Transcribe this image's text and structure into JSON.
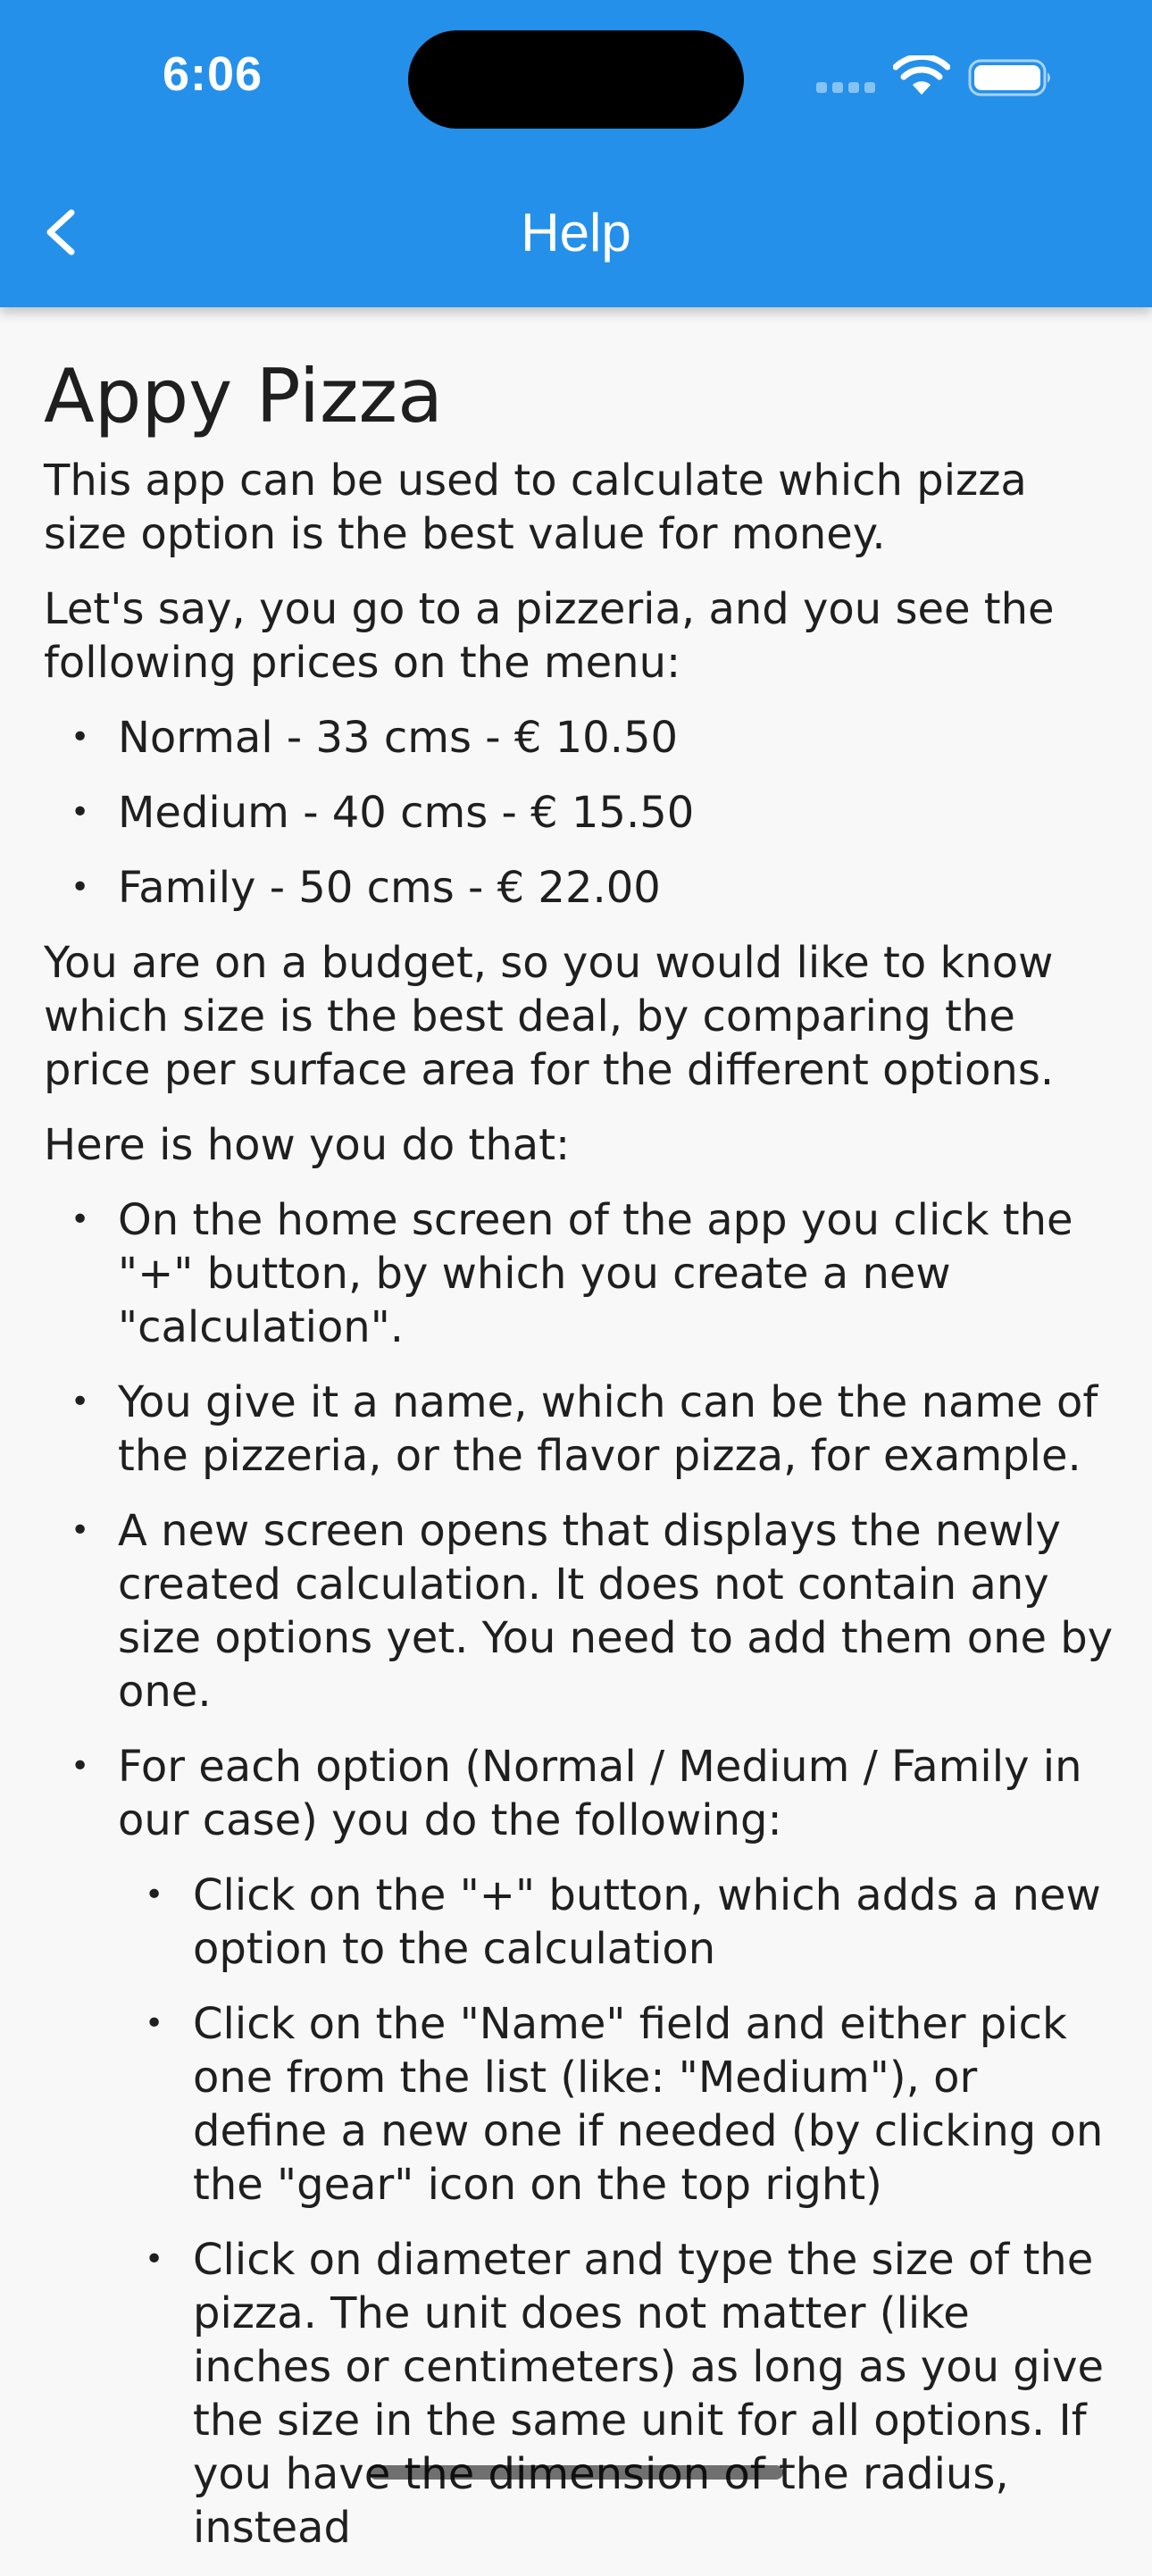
{
  "status_bar": {
    "time": "6:06"
  },
  "app_bar": {
    "title": "Help",
    "back_icon": "chevron-left-icon",
    "background": "#2590ea"
  },
  "content": {
    "heading": "Appy Pizza",
    "intro": "This app can be used to calculate which pizza size option is the best value for money.",
    "scenario": "Let's say, you go to a pizzeria, and you see the following prices on the menu:",
    "menu_items": [
      "Normal - 33 cms - € 10.50",
      "Medium - 40 cms - € 15.50",
      "Family - 50 cms - € 22.00"
    ],
    "budget_text": "You are on a budget, so you would like to know which size is the best deal, by comparing the price per surface area for the different options.",
    "howto_intro": "Here is how you do that:",
    "steps": [
      "On the home screen of the app you click the \"+\" button, by which you create a new \"calculation\".",
      "You give it a name, which can be the name of the pizzeria, or the flavor pizza, for example.",
      "A new screen opens that displays the newly created calculation. It does not contain any size options yet. You need to add them one by one.",
      "For each option (Normal / Medium / Family in our case) you do the following:"
    ],
    "sub_steps": [
      "Click on the \"+\" button, which adds a new option to the calculation",
      "Click on the \"Name\" field and either pick one from the list (like: \"Medium\"), or define a new one if needed (by clicking on the \"gear\" icon on the top right)",
      "Click on diameter and type the size of the pizza. The unit does not matter (like inches or centimeters) as long as you give the size in the same unit for all options. If you have the dimension of the radius, instead"
    ]
  }
}
